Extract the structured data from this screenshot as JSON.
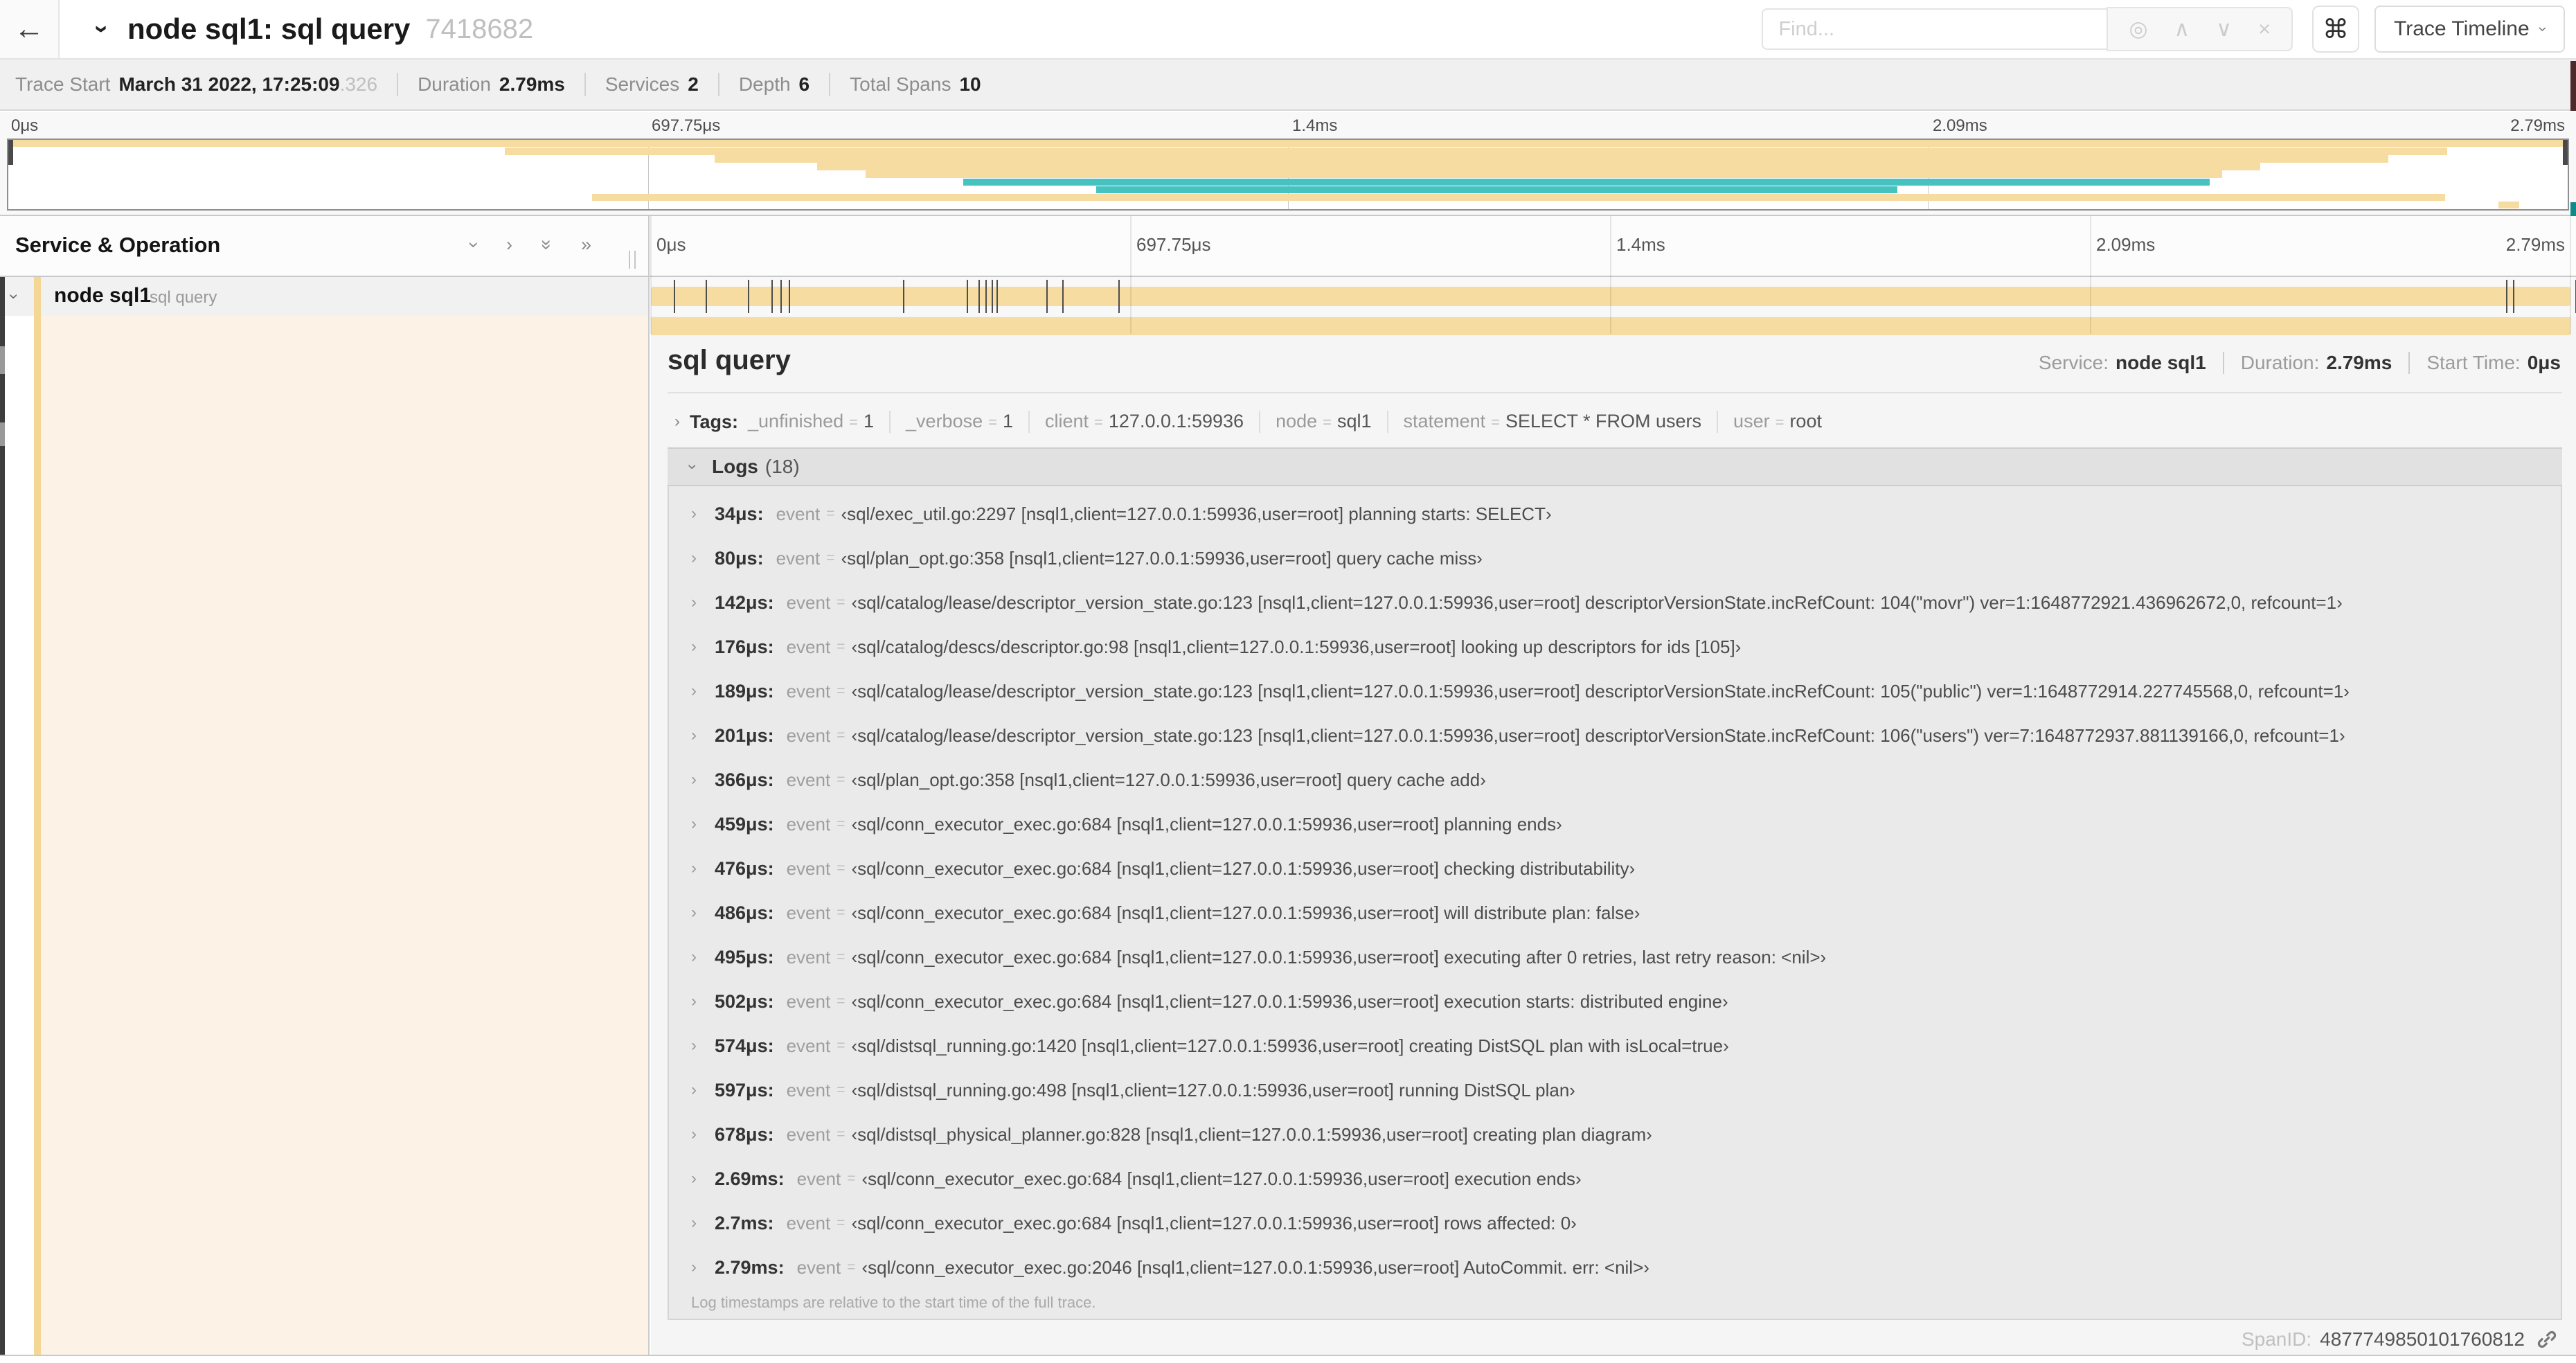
{
  "header": {
    "title": "node sql1: sql query",
    "trace_id": "7418682",
    "find_placeholder": "Find...",
    "view_button": "Trace Timeline"
  },
  "icons": {
    "back": "←",
    "chevron": "›",
    "chevron_double": "»",
    "target": "◎",
    "up": "∧",
    "down": "∨",
    "close": "×",
    "command": "⌘"
  },
  "trace_info": {
    "items": [
      {
        "label": "Trace Start",
        "value": "March 31 2022, 17:25:09",
        "suffix": ".326"
      },
      {
        "label": "Duration",
        "value": "2.79ms",
        "suffix": ""
      },
      {
        "label": "Services",
        "value": "2",
        "suffix": ""
      },
      {
        "label": "Depth",
        "value": "6",
        "suffix": ""
      },
      {
        "label": "Total Spans",
        "value": "10",
        "suffix": ""
      }
    ]
  },
  "timeline": {
    "ticks": [
      "0μs",
      "697.75μs",
      "1.4ms",
      "2.09ms",
      "2.79ms"
    ],
    "tick_pct": [
      0,
      25,
      50,
      75,
      100
    ],
    "total_us": 2790,
    "left_header": "Service & Operation"
  },
  "minimap": {
    "palette": {
      "tan": "#f7dca1",
      "teal": "#46c3c0"
    },
    "spans": [
      {
        "row": 0,
        "start": 0,
        "end": 100,
        "c": "tan"
      },
      {
        "row": 1,
        "start": 19.4,
        "end": 95.3,
        "c": "tan"
      },
      {
        "row": 2,
        "start": 27.6,
        "end": 93,
        "c": "tan"
      },
      {
        "row": 3,
        "start": 31.6,
        "end": 88,
        "c": "tan"
      },
      {
        "row": 4,
        "start": 33.5,
        "end": 86.5,
        "c": "tan"
      },
      {
        "row": 5,
        "start": 37.3,
        "end": 86,
        "c": "teal"
      },
      {
        "row": 6,
        "start": 42.5,
        "end": 73.8,
        "c": "teal"
      },
      {
        "row": 7,
        "start": 22.8,
        "end": 95.2,
        "c": "tan"
      },
      {
        "row": 8,
        "start": 97.3,
        "end": 98.1,
        "c": "tan"
      }
    ]
  },
  "span_row": {
    "service": "node sql1",
    "operation": "sql query"
  },
  "detail": {
    "title": "sql query",
    "meta": [
      {
        "label": "Service:",
        "value": "node sql1"
      },
      {
        "label": "Duration:",
        "value": "2.79ms"
      },
      {
        "label": "Start Time:",
        "value": "0μs"
      }
    ],
    "tags_label": "Tags:",
    "tags_eq": "=",
    "tags": [
      {
        "key": "_unfinished",
        "value": "1"
      },
      {
        "key": "_verbose",
        "value": "1"
      },
      {
        "key": "client",
        "value": "127.0.0.1:59936"
      },
      {
        "key": "node",
        "value": "sql1"
      },
      {
        "key": "statement",
        "value": "SELECT * FROM users"
      },
      {
        "key": "user",
        "value": "root"
      }
    ],
    "logs_label": "Logs",
    "logs_count": "(18)",
    "event_label": "event",
    "logs": [
      {
        "time": "34μs:",
        "us": 34,
        "value": "‹sql/exec_util.go:2297 [nsql1,client=127.0.0.1:59936,user=root] planning starts: SELECT›"
      },
      {
        "time": "80μs:",
        "us": 80,
        "value": "‹sql/plan_opt.go:358 [nsql1,client=127.0.0.1:59936,user=root] query cache miss›"
      },
      {
        "time": "142μs:",
        "us": 142,
        "value": "‹sql/catalog/lease/descriptor_version_state.go:123 [nsql1,client=127.0.0.1:59936,user=root] descriptorVersionState.incRefCount: 104(\"movr\") ver=1:1648772921.436962672,0, refcount=1›"
      },
      {
        "time": "176μs:",
        "us": 176,
        "value": "‹sql/catalog/descs/descriptor.go:98 [nsql1,client=127.0.0.1:59936,user=root] looking up descriptors for ids [105]›"
      },
      {
        "time": "189μs:",
        "us": 189,
        "value": "‹sql/catalog/lease/descriptor_version_state.go:123 [nsql1,client=127.0.0.1:59936,user=root] descriptorVersionState.incRefCount: 105(\"public\") ver=1:1648772914.227745568,0, refcount=1›"
      },
      {
        "time": "201μs:",
        "us": 201,
        "value": "‹sql/catalog/lease/descriptor_version_state.go:123 [nsql1,client=127.0.0.1:59936,user=root] descriptorVersionState.incRefCount: 106(\"users\") ver=7:1648772937.881139166,0, refcount=1›"
      },
      {
        "time": "366μs:",
        "us": 366,
        "value": "‹sql/plan_opt.go:358 [nsql1,client=127.0.0.1:59936,user=root] query cache add›"
      },
      {
        "time": "459μs:",
        "us": 459,
        "value": "‹sql/conn_executor_exec.go:684 [nsql1,client=127.0.0.1:59936,user=root] planning ends›"
      },
      {
        "time": "476μs:",
        "us": 476,
        "value": "‹sql/conn_executor_exec.go:684 [nsql1,client=127.0.0.1:59936,user=root] checking distributability›"
      },
      {
        "time": "486μs:",
        "us": 486,
        "value": "‹sql/conn_executor_exec.go:684 [nsql1,client=127.0.0.1:59936,user=root] will distribute plan: false›"
      },
      {
        "time": "495μs:",
        "us": 495,
        "value": "‹sql/conn_executor_exec.go:684 [nsql1,client=127.0.0.1:59936,user=root] executing after 0 retries, last retry reason: <nil>›"
      },
      {
        "time": "502μs:",
        "us": 502,
        "value": "‹sql/conn_executor_exec.go:684 [nsql1,client=127.0.0.1:59936,user=root] execution starts: distributed engine›"
      },
      {
        "time": "574μs:",
        "us": 574,
        "value": "‹sql/distsql_running.go:1420 [nsql1,client=127.0.0.1:59936,user=root] creating DistSQL plan with isLocal=true›"
      },
      {
        "time": "597μs:",
        "us": 597,
        "value": "‹sql/distsql_running.go:498 [nsql1,client=127.0.0.1:59936,user=root] running DistSQL plan›"
      },
      {
        "time": "678μs:",
        "us": 678,
        "value": "‹sql/distsql_physical_planner.go:828 [nsql1,client=127.0.0.1:59936,user=root] creating plan diagram›"
      },
      {
        "time": "2.69ms:",
        "us": 2690,
        "value": "‹sql/conn_executor_exec.go:684 [nsql1,client=127.0.0.1:59936,user=root] execution ends›"
      },
      {
        "time": "2.7ms:",
        "us": 2700,
        "value": "‹sql/conn_executor_exec.go:684 [nsql1,client=127.0.0.1:59936,user=root] rows affected: 0›"
      },
      {
        "time": "2.79ms:",
        "us": 2790,
        "value": "‹sql/conn_executor_exec.go:2046 [nsql1,client=127.0.0.1:59936,user=root] AutoCommit. err: <nil>›"
      }
    ],
    "footer": "Log timestamps are relative to the start time of the full trace.",
    "span_id_label": "SpanID:",
    "span_id": "4877749850101760812"
  }
}
